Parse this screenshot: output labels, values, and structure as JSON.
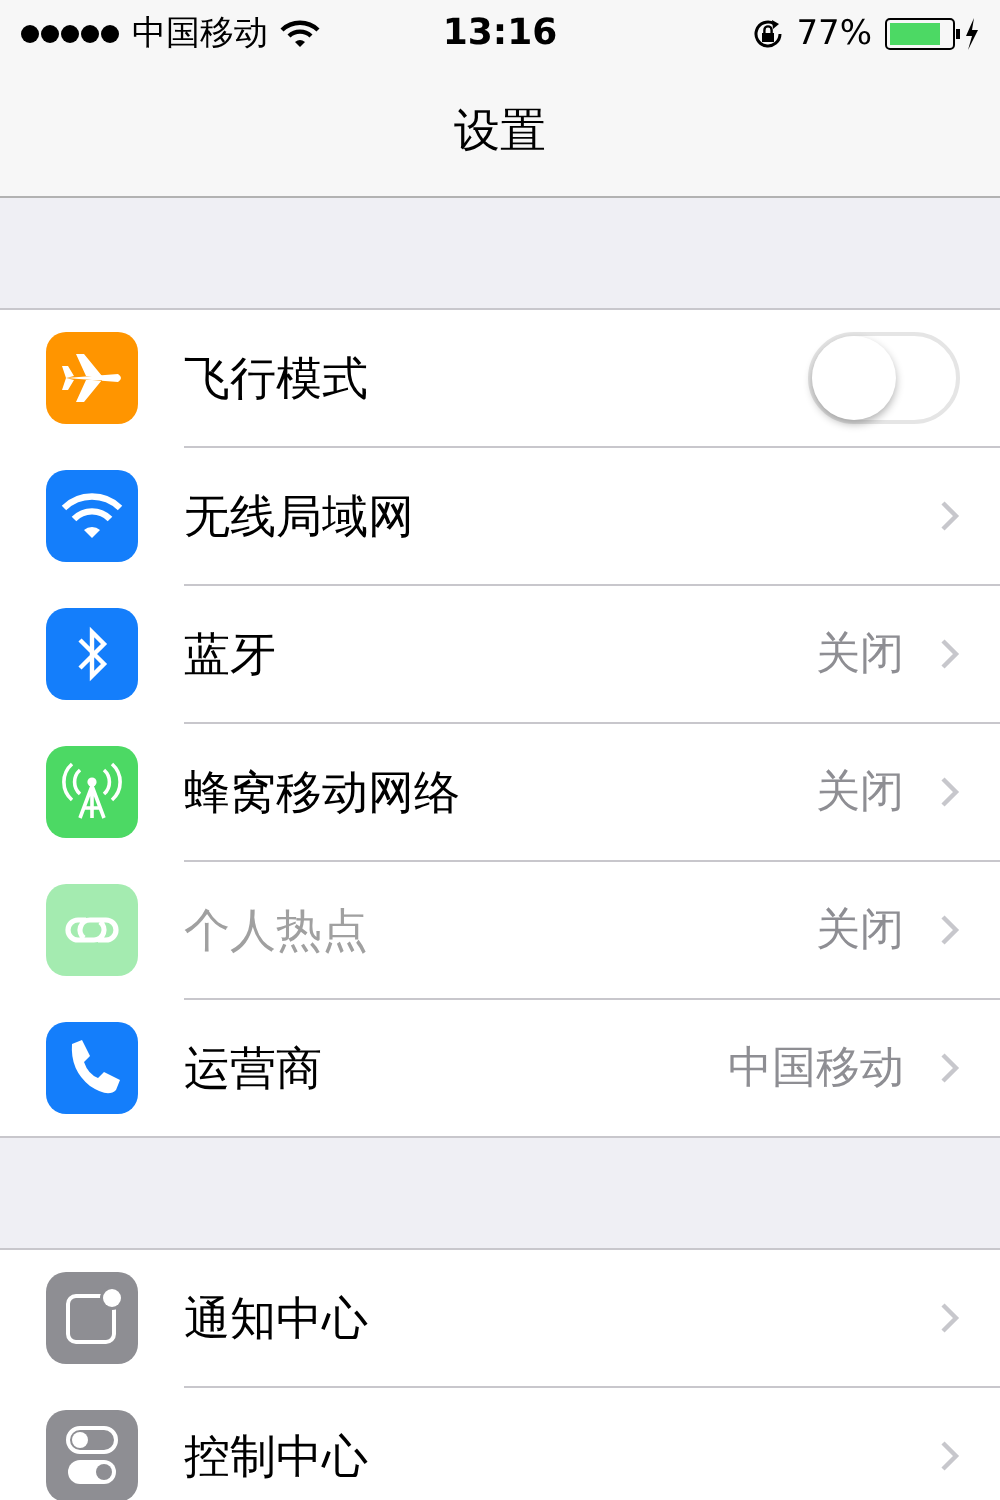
{
  "status_bar": {
    "carrier": "中国移动",
    "time": "13:16",
    "battery": "77%"
  },
  "nav": {
    "title": "设置"
  },
  "groups": [
    {
      "rows": [
        {
          "kind": "toggle",
          "label": "飞行模式",
          "on": false,
          "disabled": false
        },
        {
          "kind": "link",
          "label": "无线局域网",
          "disabled": false
        },
        {
          "kind": "link",
          "label": "蓝牙",
          "detail": "关闭",
          "disabled": false
        },
        {
          "kind": "link",
          "label": "蜂窝移动网络",
          "detail": "关闭",
          "disabled": false
        },
        {
          "kind": "link",
          "label": "个人热点",
          "detail": "关闭",
          "disabled": true
        },
        {
          "kind": "link",
          "label": "运营商",
          "detail": "中国移动",
          "disabled": false
        }
      ]
    },
    {
      "rows": [
        {
          "kind": "link",
          "label": "通知中心",
          "disabled": false
        },
        {
          "kind": "link",
          "label": "控制中心",
          "disabled": false
        }
      ]
    }
  ]
}
